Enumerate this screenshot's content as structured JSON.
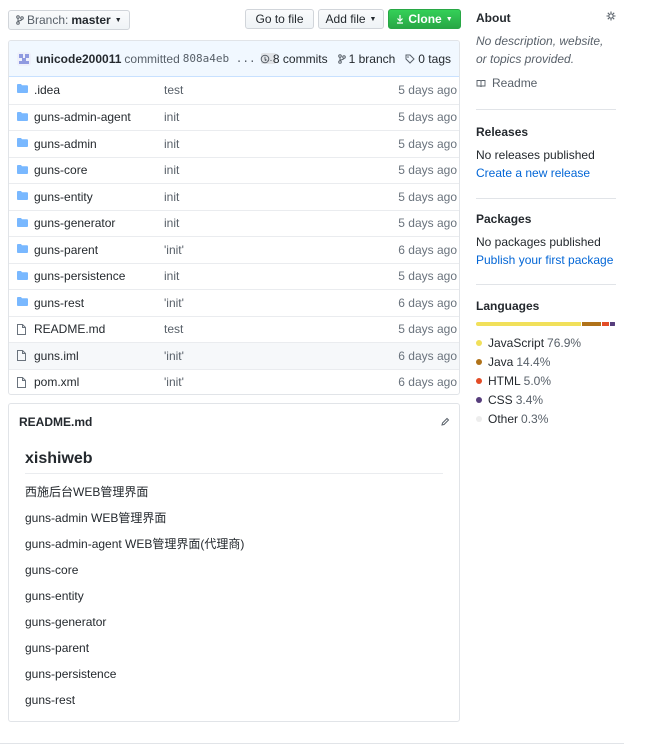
{
  "toolbar": {
    "branch_label": "Branch:",
    "branch_value": "master",
    "goto_file": "Go to file",
    "add_file": "Add file",
    "clone": "Clone"
  },
  "commit": {
    "author": "unicode200011",
    "action": "committed",
    "hash": "808a4eb",
    "ellipsis_hash": "...",
    "ellipsis": "…",
    "commits": "8 commits",
    "branches": "1 branch",
    "tags": "0 tags"
  },
  "files": [
    {
      "type": "dir",
      "name": ".idea",
      "message": "test",
      "age": "5 days ago"
    },
    {
      "type": "dir",
      "name": "guns-admin-agent",
      "message": "init",
      "age": "5 days ago"
    },
    {
      "type": "dir",
      "name": "guns-admin",
      "message": "init",
      "age": "5 days ago"
    },
    {
      "type": "dir",
      "name": "guns-core",
      "message": "init",
      "age": "5 days ago"
    },
    {
      "type": "dir",
      "name": "guns-entity",
      "message": "init",
      "age": "5 days ago"
    },
    {
      "type": "dir",
      "name": "guns-generator",
      "message": "init",
      "age": "5 days ago"
    },
    {
      "type": "dir",
      "name": "guns-parent",
      "message": "'init'",
      "age": "6 days ago"
    },
    {
      "type": "dir",
      "name": "guns-persistence",
      "message": "init",
      "age": "5 days ago"
    },
    {
      "type": "dir",
      "name": "guns-rest",
      "message": "'init'",
      "age": "6 days ago"
    },
    {
      "type": "file",
      "name": "README.md",
      "message": "test",
      "age": "5 days ago"
    },
    {
      "type": "file",
      "name": "guns.iml",
      "message": "'init'",
      "age": "6 days ago"
    },
    {
      "type": "file",
      "name": "pom.xml",
      "message": "'init'",
      "age": "6 days ago"
    }
  ],
  "readme": {
    "filename": "README.md",
    "heading": "xishiweb",
    "lines": [
      "西施后台WEB管理界面",
      "guns-admin WEB管理界面",
      "guns-admin-agent WEB管理界面(代理商)",
      "guns-core",
      "guns-entity",
      "guns-generator",
      "guns-parent",
      "guns-persistence",
      "guns-rest"
    ]
  },
  "about": {
    "title": "About",
    "description": "No description, website, or topics provided.",
    "readme_link": "Readme"
  },
  "releases": {
    "title": "Releases",
    "text": "No releases published",
    "link": "Create a new release"
  },
  "packages": {
    "title": "Packages",
    "text": "No packages published",
    "link": "Publish your first package"
  },
  "languages": {
    "title": "Languages",
    "items": [
      {
        "name": "JavaScript",
        "percent": "76.9%",
        "value": 76.9,
        "color": "#f1e05a"
      },
      {
        "name": "Java",
        "percent": "14.4%",
        "value": 14.4,
        "color": "#b07219"
      },
      {
        "name": "HTML",
        "percent": "5.0%",
        "value": 5.0,
        "color": "#e34c26"
      },
      {
        "name": "CSS",
        "percent": "3.4%",
        "value": 3.4,
        "color": "#563d7c"
      },
      {
        "name": "Other",
        "percent": "0.3%",
        "value": 0.3,
        "color": "#ededed"
      }
    ]
  }
}
